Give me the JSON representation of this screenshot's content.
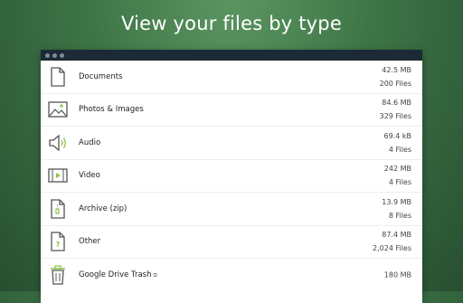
{
  "headline": "View your files by type",
  "colors": {
    "accent": "#8bc34a",
    "icon": "#555555",
    "titlebar": "#1c2a36"
  },
  "rows": [
    {
      "icon": "document-icon",
      "label": "Documents",
      "size": "42.5 MB",
      "count": "200 Files"
    },
    {
      "icon": "image-icon",
      "label": "Photos & Images",
      "size": "84.6 MB",
      "count": "329 Files"
    },
    {
      "icon": "audio-icon",
      "label": "Audio",
      "size": "69.4 kB",
      "count": "4 Files"
    },
    {
      "icon": "video-icon",
      "label": "Video",
      "size": "242 MB",
      "count": "4 Files"
    },
    {
      "icon": "archive-icon",
      "label": "Archive (zip)",
      "size": "13.9 MB",
      "count": "8 Files"
    },
    {
      "icon": "other-file-icon",
      "label": "Other",
      "size": "87.4 MB",
      "count": "2,024 Files"
    },
    {
      "icon": "trash-icon",
      "label": "Google Drive Trash",
      "size": "180 MB",
      "count": ""
    }
  ]
}
